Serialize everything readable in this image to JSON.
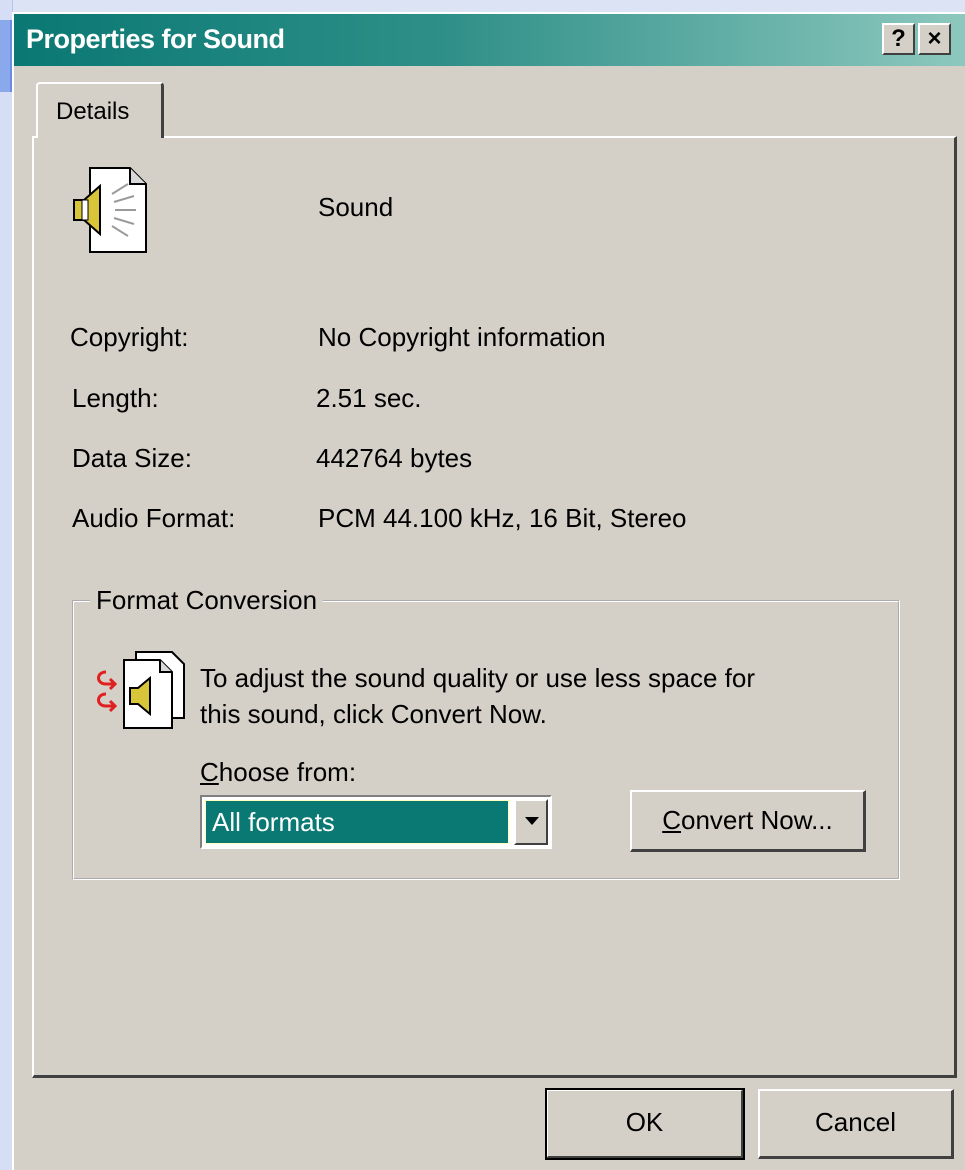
{
  "window": {
    "title": "Properties for Sound",
    "help_glyph": "?",
    "close_glyph": "×"
  },
  "tabs": [
    {
      "label": "Details"
    }
  ],
  "file": {
    "name": "Sound",
    "icon": "sound-file-icon"
  },
  "details": [
    {
      "label": "Copyright:",
      "value": "No Copyright information"
    },
    {
      "label": "Length:",
      "value": "2.51 sec."
    },
    {
      "label": "Data Size:",
      "value": "442764 bytes"
    },
    {
      "label": "Audio Format:",
      "value": "PCM 44.100 kHz, 16 Bit, Stereo"
    }
  ],
  "format_conversion": {
    "group_title": "Format Conversion",
    "icon": "convert-sound-icon",
    "description_line1": "To adjust the sound quality or use less space for",
    "description_line2": "this sound, click Convert Now.",
    "choose_label": "Choose from:",
    "selected_option": "All formats",
    "convert_button": "Convert Now..."
  },
  "footer": {
    "ok_label": "OK",
    "cancel_label": "Cancel"
  },
  "colors": {
    "titlebar_start": "#0a7873",
    "titlebar_end": "#8dc8be",
    "dialog_face": "#d4d0c8",
    "selection": "#0a7873"
  }
}
